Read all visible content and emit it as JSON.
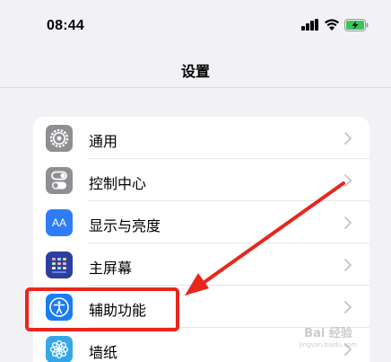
{
  "status_bar": {
    "time": "08:44",
    "icons": [
      "signal-icon",
      "wifi-icon",
      "battery-charging-icon"
    ]
  },
  "nav": {
    "title": "设置"
  },
  "settings_items": [
    {
      "label": "通用",
      "icon": "gear-icon",
      "icon_color": "#8e8e93"
    },
    {
      "label": "控制中心",
      "icon": "toggles-icon",
      "icon_color": "#8e8e93"
    },
    {
      "label": "显示与亮度",
      "icon": "text-size-icon",
      "icon_color": "#2f7cf6",
      "icon_text": "AA"
    },
    {
      "label": "主屏幕",
      "icon": "home-screen-grid-icon",
      "icon_color": "#2a3fa0"
    },
    {
      "label": "辅助功能",
      "icon": "accessibility-icon",
      "icon_color": "#1a7cf5"
    },
    {
      "label": "墙纸",
      "icon": "wallpaper-flower-icon",
      "icon_color": "#35a7e8"
    }
  ],
  "annotation": {
    "highlighted_item": "辅助功能",
    "color": "#e8261b"
  },
  "watermark": {
    "text": "Bai 经验",
    "sub": "jingyan.baidu.com"
  },
  "colors": {
    "background": "#f2f2f6",
    "card": "#ffffff",
    "chevron": "#c4c4c7"
  }
}
